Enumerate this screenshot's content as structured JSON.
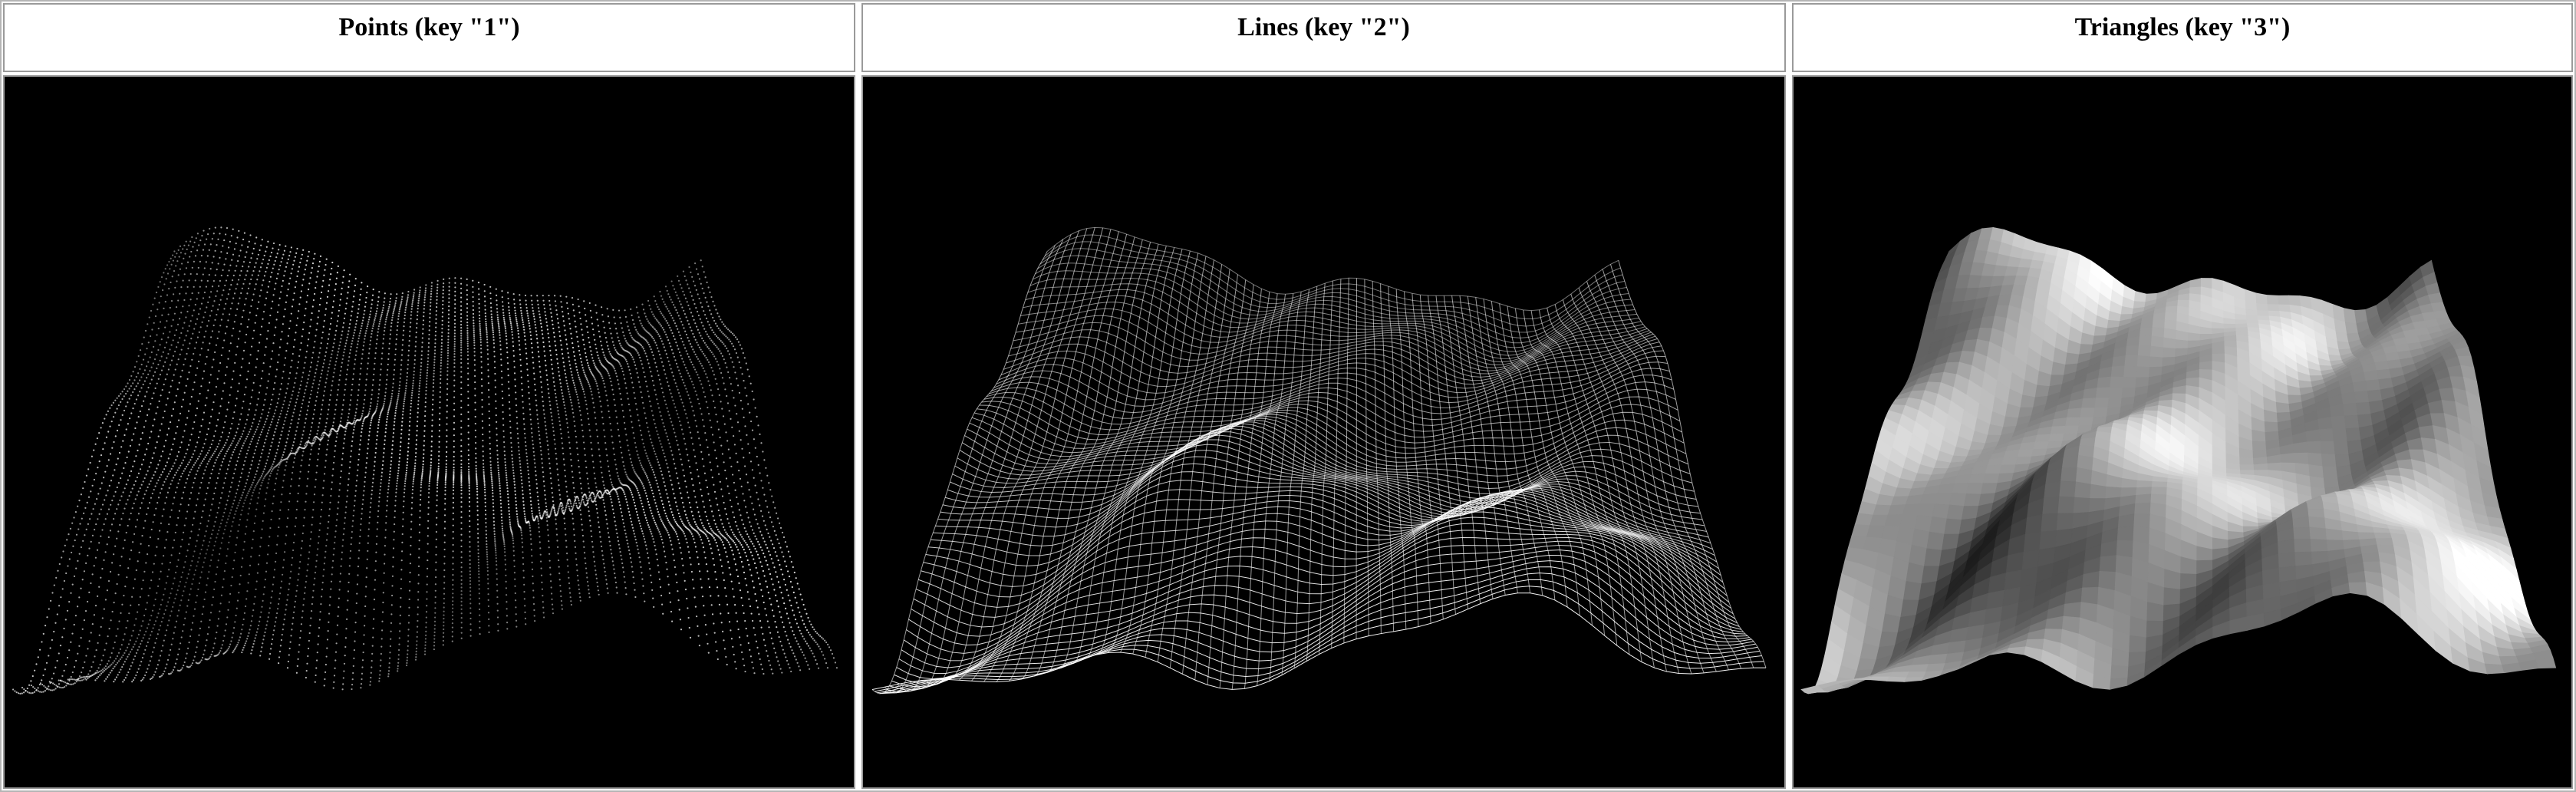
{
  "panels": [
    {
      "id": "points",
      "title": "Points (key \"1\")",
      "render_mode": "points"
    },
    {
      "id": "lines",
      "title": "Lines (key \"2\")",
      "render_mode": "lines"
    },
    {
      "id": "triangles",
      "title": "Triangles (key \"3\")",
      "render_mode": "triangles"
    }
  ],
  "colors": {
    "background": "#000000",
    "page": "#ffffff",
    "border": "#9a9a9a",
    "mesh": "#ffffff"
  }
}
